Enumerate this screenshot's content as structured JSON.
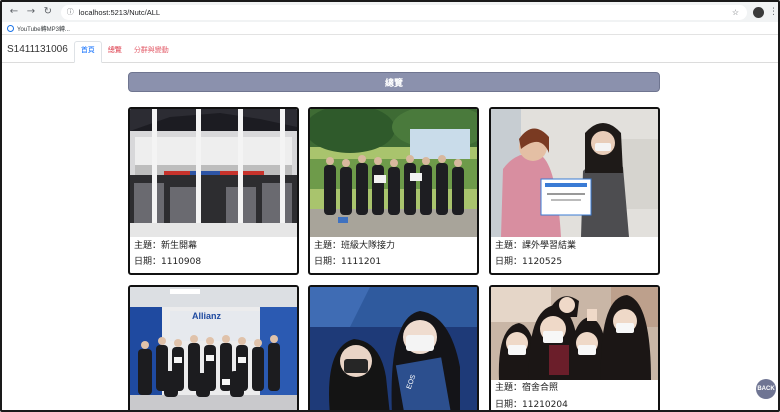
{
  "browser": {
    "url": "localhost:5213/Nutc/ALL",
    "bookmark": "YouTube轉MP3轉..."
  },
  "nav": {
    "brand": "S1411131006",
    "tabs": [
      {
        "label": "首頁",
        "state": "active"
      },
      {
        "label": "總覽"
      },
      {
        "label": "分群與變動"
      }
    ]
  },
  "page": {
    "header": "總覽",
    "back_label": "BACK"
  },
  "cards": [
    {
      "theme": "主題：新生開幕",
      "date": "日期：1110908"
    },
    {
      "theme": "主題：班級大隊接力",
      "date": "日期：1111201"
    },
    {
      "theme": "主題：課外學習結業",
      "date": "日期：1120525"
    },
    {
      "theme": "",
      "date": ""
    },
    {
      "theme": "",
      "date": ""
    },
    {
      "theme": "主題：宿舍合照",
      "date": "日期：11210204"
    }
  ],
  "colors": {
    "header_bar": "#8b91ad",
    "active_tab": "#0d6efd",
    "tab_red": "#dc3545",
    "back_button": "#6f7593"
  }
}
